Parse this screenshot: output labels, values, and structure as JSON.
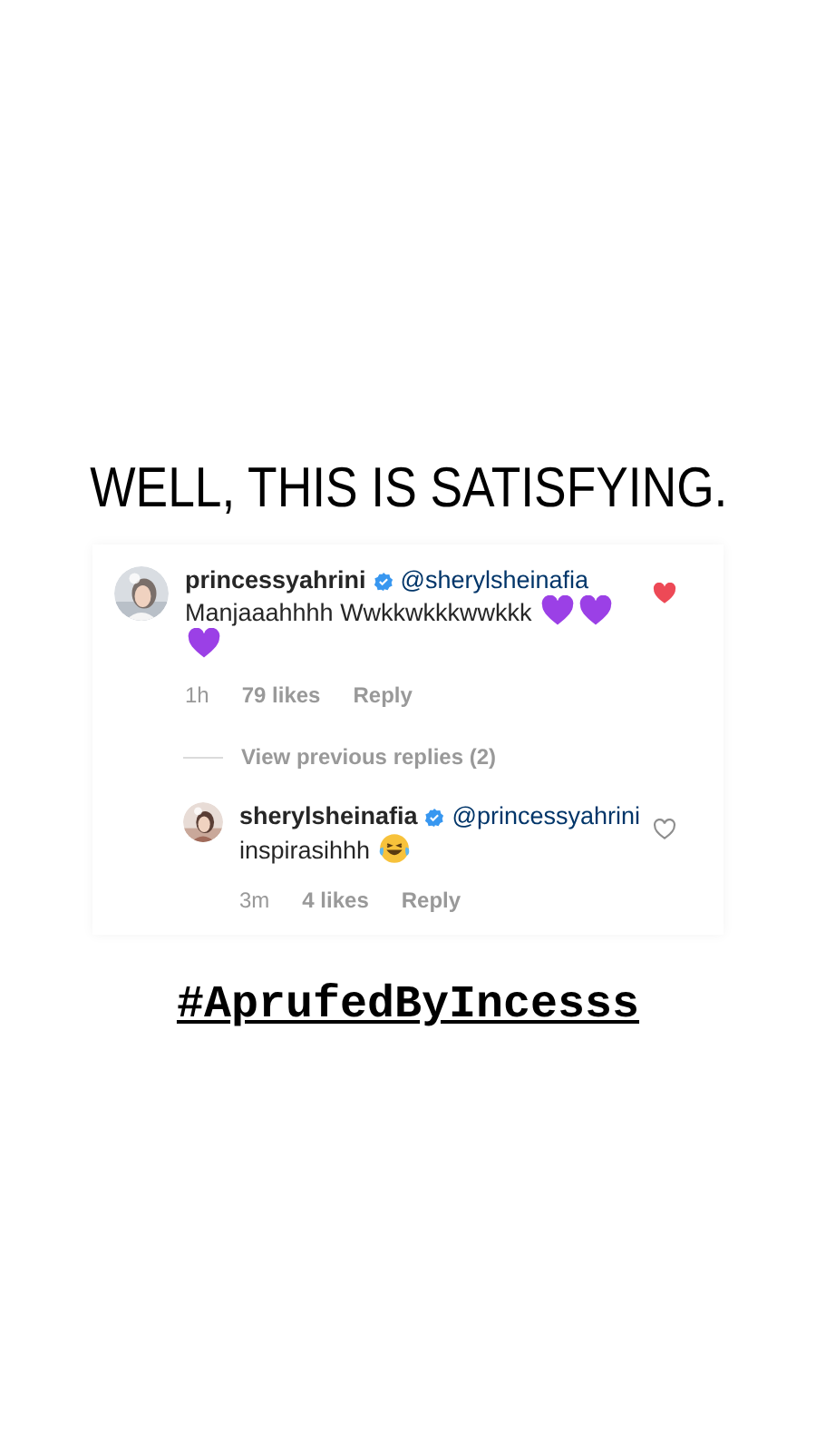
{
  "headline": "WELL, THIS IS SATISFYING.",
  "comment": {
    "username": "princessyahrini",
    "mention": "@sherylsheinafia",
    "text": "Manjaaahhhh Wwkkwkkkwwkkk",
    "emojis": [
      {
        "kind": "purple-heart"
      },
      {
        "kind": "purple-heart"
      },
      {
        "kind": "purple-heart"
      }
    ],
    "time": "1h",
    "likes": "79 likes",
    "reply": "Reply",
    "liked": true
  },
  "view_previous": "View previous replies (2)",
  "reply": {
    "username": "sherylsheinafia",
    "mention": "@princessyahrini",
    "text": "inspirasihhh",
    "emojis": [
      {
        "kind": "laughing-tears"
      }
    ],
    "time": "3m",
    "likes": "4 likes",
    "reply": "Reply",
    "liked": false
  },
  "hashtag": "#AprufedByIncesss"
}
